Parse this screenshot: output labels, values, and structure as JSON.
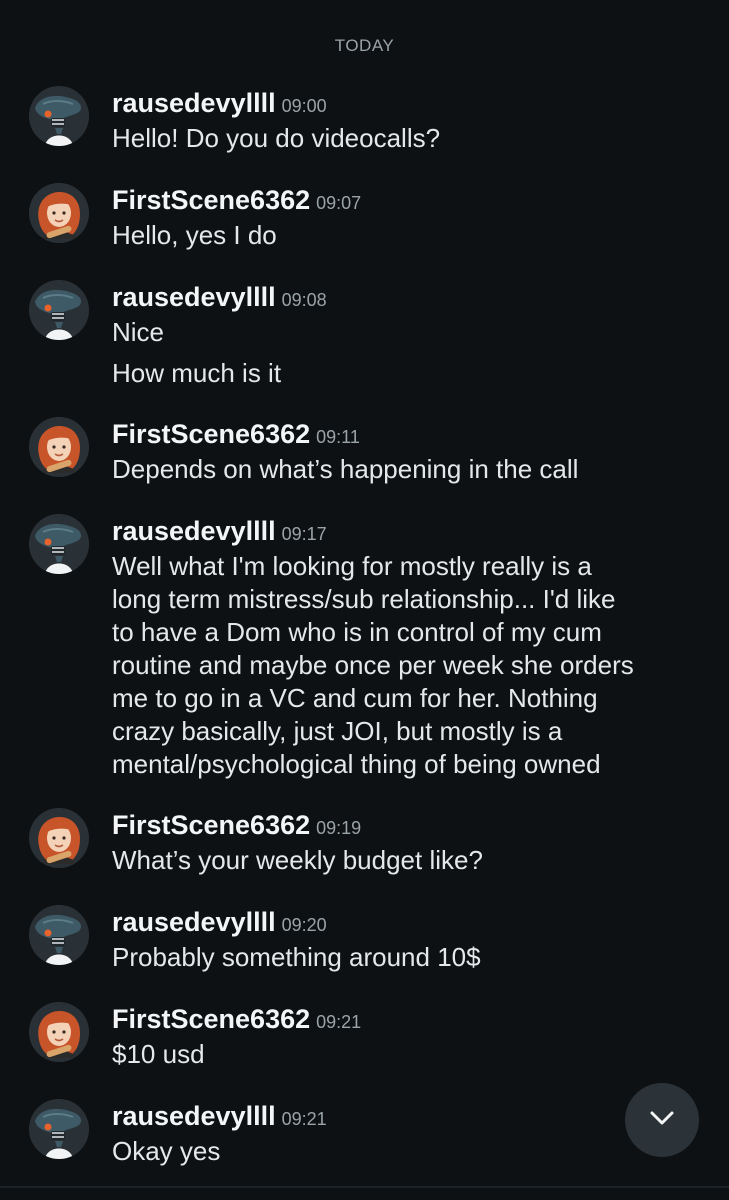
{
  "divider": {
    "label": "TODAY"
  },
  "users": {
    "a": {
      "name": "rausedevyllll",
      "avatar_icon": "alien-avatar-icon"
    },
    "b": {
      "name": "FirstScene6362",
      "avatar_icon": "redhead-avatar-icon"
    }
  },
  "messages": [
    {
      "author": "rausedevyllll",
      "time": "09:00",
      "lines": [
        "Hello! Do you do videocalls?"
      ]
    },
    {
      "author": "FirstScene6362",
      "time": "09:07",
      "lines": [
        "Hello, yes I do"
      ]
    },
    {
      "author": "rausedevyllll",
      "time": "09:08",
      "lines": [
        "Nice",
        "How much is it"
      ]
    },
    {
      "author": "FirstScene6362",
      "time": "09:11",
      "lines": [
        "Depends on what’s happening in the call"
      ]
    },
    {
      "author": "rausedevyllll",
      "time": "09:17",
      "lines": [
        "Well what I'm looking for mostly really is a",
        "long term mistress/sub relationship... I'd like",
        "to have a Dom who is in control of my cum",
        "routine and maybe once per week she orders",
        "me to go in a VC and cum for her. Nothing",
        "crazy basically, just JOI, but mostly is a",
        "mental/psychological thing of being owned"
      ]
    },
    {
      "author": "FirstScene6362",
      "time": "09:19",
      "lines": [
        "What’s your weekly budget like?"
      ]
    },
    {
      "author": "rausedevyllll",
      "time": "09:20",
      "lines": [
        "Probably something around 10$"
      ]
    },
    {
      "author": "FirstScene6362",
      "time": "09:21",
      "lines": [
        "$10 usd"
      ]
    },
    {
      "author": "rausedevyllll",
      "time": "09:21",
      "lines": [
        "Okay yes"
      ]
    }
  ],
  "scroll_button": {
    "icon": "chevron-down-icon"
  },
  "colors": {
    "background": "#0e1113",
    "text": "#e4e8ea",
    "muted": "#9aa3a8",
    "alien_head": "#3d5a66",
    "alien_eye": "#e8632b",
    "redhead_hair": "#c8542a",
    "skin": "#f3d2b8"
  }
}
